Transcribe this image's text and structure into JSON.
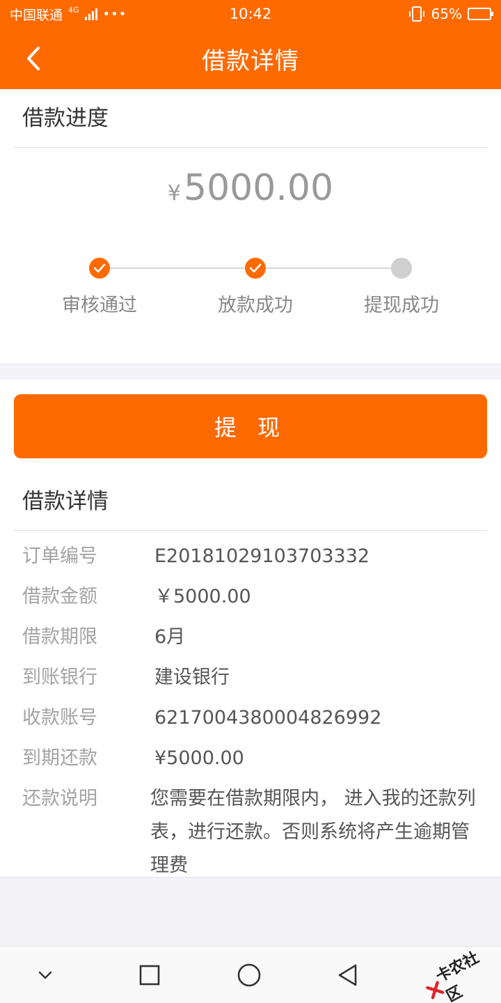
{
  "status_bar": {
    "carrier": "中国联通",
    "network": "4G",
    "dots": "•••",
    "time": "10:42",
    "battery": "65%",
    "battery_level": 0.65
  },
  "header": {
    "title": "借款详情"
  },
  "progress_card": {
    "title": "借款进度",
    "currency": "¥",
    "amount": "5000.00",
    "steps": [
      {
        "label": "审核通过",
        "status": "done"
      },
      {
        "label": "放款成功",
        "status": "done"
      },
      {
        "label": "提现成功",
        "status": "pending"
      }
    ]
  },
  "withdraw_button": {
    "label": "提 现"
  },
  "details": {
    "title": "借款详情",
    "rows": [
      {
        "key": "订单编号",
        "value": "E20181029103703332"
      },
      {
        "key": "借款金额",
        "value": "￥5000.00"
      },
      {
        "key": "借款期限",
        "value": "6月"
      },
      {
        "key": "到账银行",
        "value": "建设银行"
      },
      {
        "key": "收款账号",
        "value": "6217004380004826992"
      },
      {
        "key": "到期还款",
        "value": "¥5000.00"
      },
      {
        "key": "还款说明",
        "value": "您需要在借款期限内， 进入我的还款列表，进行还款。否则系统将产生逾期管理费"
      }
    ]
  },
  "watermark": {
    "text": "卡农社区"
  },
  "colors": {
    "accent": "#ff6a00",
    "pending": "#cfcfcf"
  }
}
